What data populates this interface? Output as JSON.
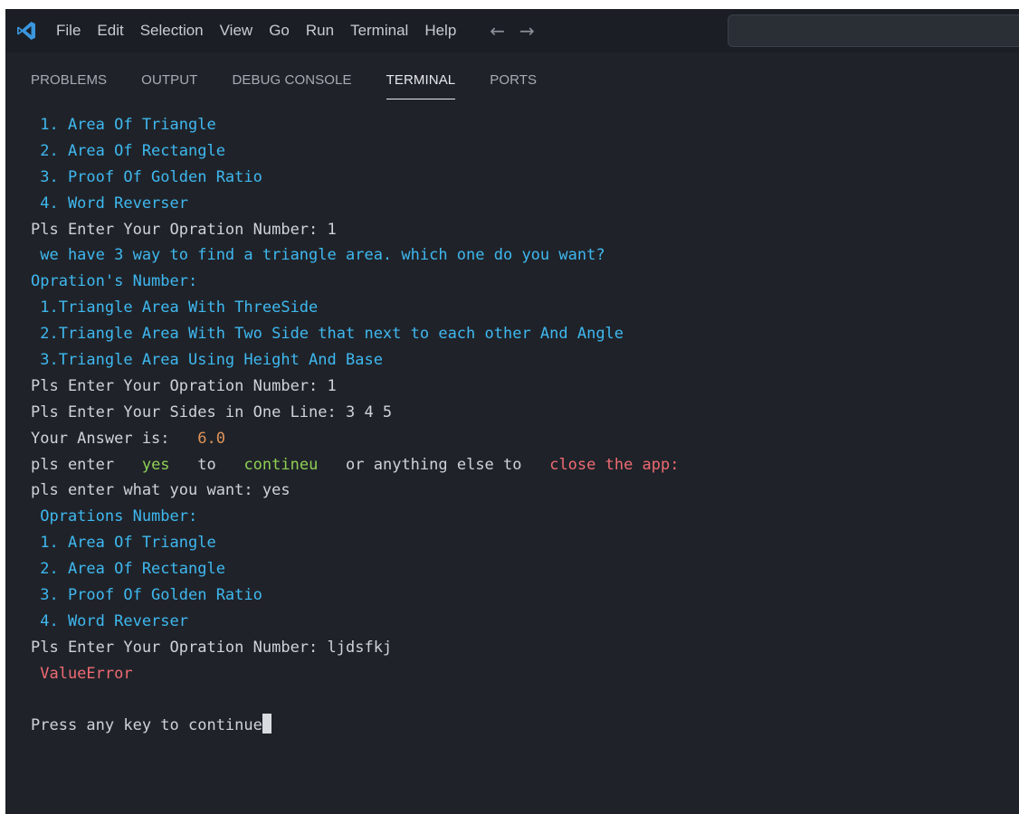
{
  "colors": {
    "background": "#1f2329",
    "titlebar": "#1b1e24",
    "text_default": "#cfd3d8",
    "text_blue": "#3fb8f0",
    "text_orange": "#e0935a",
    "text_green": "#8fcf55",
    "text_red": "#ef6a73",
    "vscode_logo": "#3a96dd"
  },
  "titlebar": {
    "logo_icon": "vscode-logo-icon",
    "menu": [
      "File",
      "Edit",
      "Selection",
      "View",
      "Go",
      "Run",
      "Terminal",
      "Help"
    ],
    "back_arrow": "←",
    "forward_arrow": "→",
    "command_center_placeholder": ""
  },
  "panel": {
    "tabs": [
      "PROBLEMS",
      "OUTPUT",
      "DEBUG CONSOLE",
      "TERMINAL",
      "PORTS"
    ],
    "active_tab": "TERMINAL"
  },
  "terminal": {
    "lines": [
      [
        {
          "t": " 1. Area Of Triangle",
          "c": "blue"
        }
      ],
      [
        {
          "t": " 2. Area Of Rectangle",
          "c": "blue"
        }
      ],
      [
        {
          "t": " 3. Proof Of Golden Ratio",
          "c": "blue"
        }
      ],
      [
        {
          "t": " 4. Word Reverser",
          "c": "blue"
        }
      ],
      [
        {
          "t": "Pls Enter Your Opration Number: 1",
          "c": "default"
        }
      ],
      [
        {
          "t": " we have 3 way to find a triangle area. which one do you want?",
          "c": "blue"
        }
      ],
      [
        {
          "t": "Opration's Number:",
          "c": "blue"
        }
      ],
      [
        {
          "t": " 1.Triangle Area With ThreeSide",
          "c": "blue"
        }
      ],
      [
        {
          "t": " 2.Triangle Area With Two Side that next to each other And Angle",
          "c": "blue"
        }
      ],
      [
        {
          "t": " 3.Triangle Area Using Height And Base",
          "c": "blue"
        }
      ],
      [
        {
          "t": "Pls Enter Your Opration Number: 1",
          "c": "default"
        }
      ],
      [
        {
          "t": "Pls Enter Your Sides in One Line: 3 4 5",
          "c": "default"
        }
      ],
      [
        {
          "t": "Your Answer is:  ",
          "c": "default"
        },
        {
          "t": " 6.0",
          "c": "orange"
        }
      ],
      [
        {
          "t": "pls enter  ",
          "c": "default"
        },
        {
          "t": " yes ",
          "c": "green"
        },
        {
          "t": "  to  ",
          "c": "default"
        },
        {
          "t": " contineu ",
          "c": "green"
        },
        {
          "t": "  or anything else to  ",
          "c": "default"
        },
        {
          "t": " close the app:",
          "c": "red"
        }
      ],
      [
        {
          "t": "pls enter what you want: yes",
          "c": "default"
        }
      ],
      [
        {
          "t": " Oprations Number:",
          "c": "blue"
        }
      ],
      [
        {
          "t": " 1. Area Of Triangle",
          "c": "blue"
        }
      ],
      [
        {
          "t": " 2. Area Of Rectangle",
          "c": "blue"
        }
      ],
      [
        {
          "t": " 3. Proof Of Golden Ratio",
          "c": "blue"
        }
      ],
      [
        {
          "t": " 4. Word Reverser",
          "c": "blue"
        }
      ],
      [
        {
          "t": "Pls Enter Your Opration Number: ljdsfkj",
          "c": "default"
        }
      ],
      [
        {
          "t": " ValueError",
          "c": "red"
        }
      ],
      [
        {
          "t": "",
          "c": "default"
        }
      ],
      [
        {
          "t": "Press any key to continue",
          "c": "default"
        }
      ]
    ]
  }
}
